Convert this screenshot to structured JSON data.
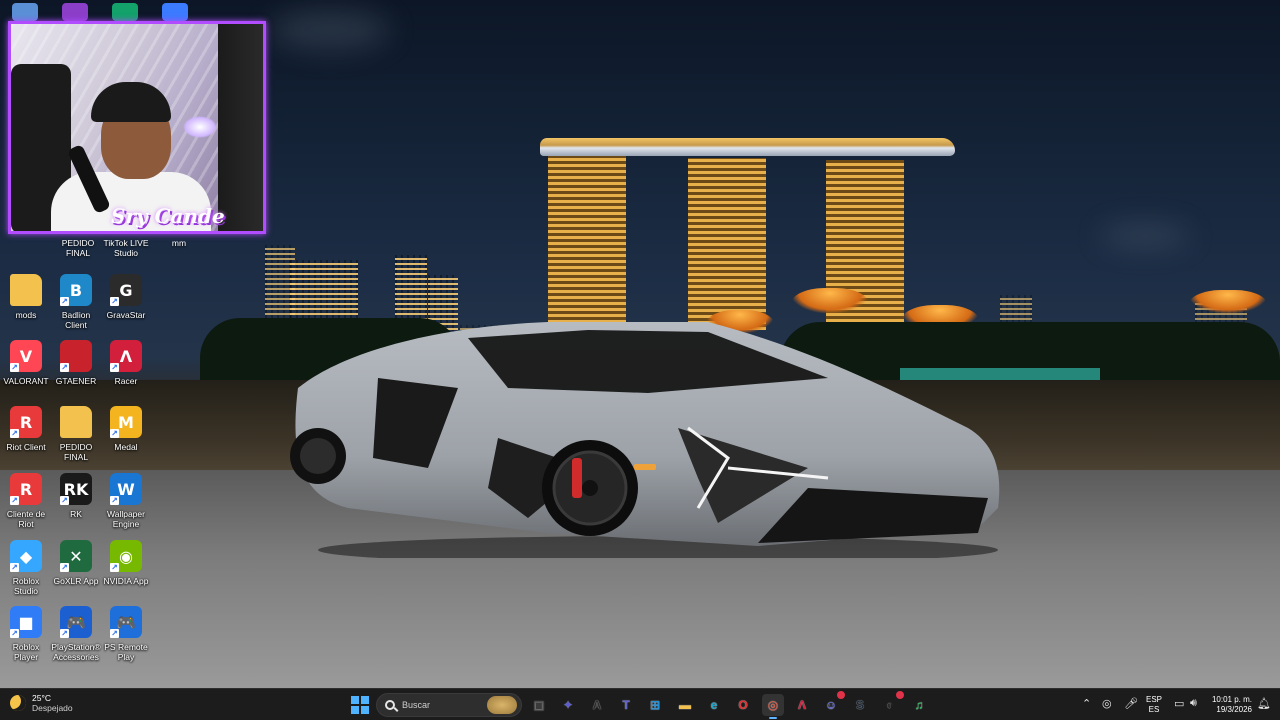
{
  "top_partial_icons": [
    {
      "icon": "settings-app-icon",
      "color": "#5a8fd6"
    },
    {
      "icon": "podcast-app-icon",
      "color": "#8b3ec8"
    },
    {
      "icon": "signal-app-icon",
      "color": "#12a26a"
    },
    {
      "icon": "bluesky-app-icon",
      "color": "#3b7bff"
    }
  ],
  "webcam": {
    "overlay_text": "Sry Cande"
  },
  "desktop_row_partial": [
    {
      "label": "PEDIDO FINAL"
    },
    {
      "label": "TikTok LIVE Studio"
    },
    {
      "label": "mm"
    }
  ],
  "desktop_icons": [
    {
      "label": "mods",
      "icon": "folder-icon",
      "color": "#f2c14e",
      "glyph": ""
    },
    {
      "label": "Badlion Client",
      "icon": "badlion-icon",
      "color": "#1e88c8",
      "glyph": "B"
    },
    {
      "label": "GravaStar",
      "icon": "gravastar-icon",
      "color": "#2b2b2b",
      "glyph": "G"
    },
    {
      "label": "VALORANT",
      "icon": "valorant-icon",
      "color": "#ff4655",
      "glyph": "V"
    },
    {
      "label": "GTAENER",
      "icon": "gta-icon",
      "color": "#c8232c",
      "glyph": ""
    },
    {
      "label": "Racer",
      "icon": "racer-icon",
      "color": "#d21f3c",
      "glyph": "Λ"
    },
    {
      "label": "Riot Client",
      "icon": "riot-client-icon",
      "color": "#e83a3a",
      "glyph": "R"
    },
    {
      "label": "PEDIDO FINAL",
      "icon": "folder-icon",
      "color": "#f2c14e",
      "glyph": ""
    },
    {
      "label": "Medal",
      "icon": "medal-icon",
      "color": "#f3b41f",
      "glyph": "M"
    },
    {
      "label": "Cliente de Riot",
      "icon": "riot-client-icon",
      "color": "#e83a3a",
      "glyph": "R"
    },
    {
      "label": "RK",
      "icon": "rk-icon",
      "color": "#1a1a1a",
      "glyph": "RK"
    },
    {
      "label": "Wallpaper Engine",
      "icon": "wallpaper-engine-icon",
      "color": "#1976d2",
      "glyph": "W"
    },
    {
      "label": "Roblox Studio",
      "icon": "roblox-studio-icon",
      "color": "#35a7ff",
      "glyph": "◆"
    },
    {
      "label": "GoXLR App",
      "icon": "goxlr-icon",
      "color": "#1f6b3f",
      "glyph": "✕"
    },
    {
      "label": "NVIDIA App",
      "icon": "nvidia-icon",
      "color": "#76b900",
      "glyph": "◉"
    },
    {
      "label": "Roblox Player",
      "icon": "roblox-player-icon",
      "color": "#2f7cf6",
      "glyph": "■"
    },
    {
      "label": "PlayStation® Accessories",
      "icon": "playstation-accessories-icon",
      "color": "#1c5fd1",
      "glyph": "🎮"
    },
    {
      "label": "PS Remote Play",
      "icon": "ps-remote-play-icon",
      "color": "#1f6fdb",
      "glyph": "🎮"
    }
  ],
  "taskbar": {
    "weather": {
      "temp": "25°C",
      "condition": "Despejado"
    },
    "search_placeholder": "Buscar",
    "apps": [
      {
        "name": "task-view",
        "glyph": "▣",
        "color": "#3a3a3a"
      },
      {
        "name": "copilot",
        "glyph": "✦",
        "color": "#5b5bd6"
      },
      {
        "name": "app-a",
        "glyph": "A",
        "color": "#2b2b2b"
      },
      {
        "name": "teams",
        "glyph": "T",
        "color": "#5b5fc7"
      },
      {
        "name": "store",
        "glyph": "⊞",
        "color": "#1f8fd8"
      },
      {
        "name": "file-explorer",
        "glyph": "▬",
        "color": "#f2c14e"
      },
      {
        "name": "edge",
        "glyph": "e",
        "color": "#1ba1c7"
      },
      {
        "name": "opera",
        "glyph": "O",
        "color": "#e22d2d"
      },
      {
        "name": "chrome",
        "glyph": "◎",
        "color": "#e44b35"
      },
      {
        "name": "racer-app",
        "glyph": "Λ",
        "color": "#d21f3c"
      },
      {
        "name": "discord",
        "glyph": "☺",
        "color": "#5865f2"
      },
      {
        "name": "steam",
        "glyph": "S",
        "color": "#1b2838"
      },
      {
        "name": "obs",
        "glyph": "◐",
        "color": "#2b2b2b"
      },
      {
        "name": "spotify",
        "glyph": "♫",
        "color": "#1db954"
      }
    ],
    "tray": {
      "lang_top": "ESP",
      "lang_bottom": "ES",
      "time": "10:01 p. m.",
      "date": "19/3/2026"
    }
  }
}
